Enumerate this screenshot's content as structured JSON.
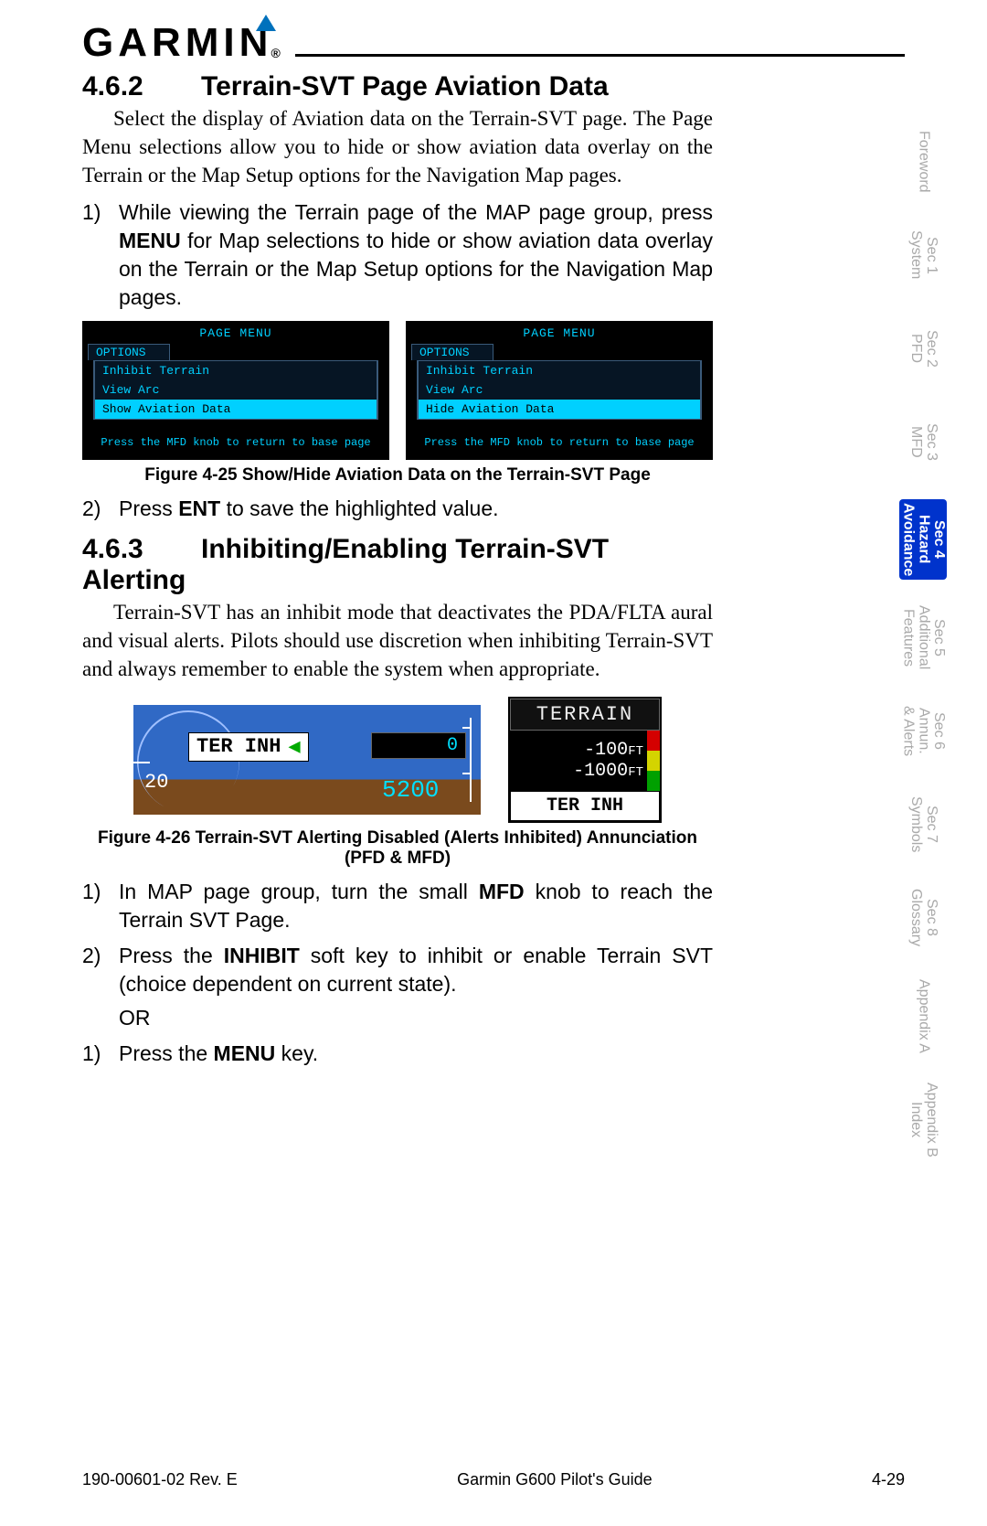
{
  "header": {
    "brand": "GARMIN",
    "reg": "®"
  },
  "tabs": [
    {
      "label": "Foreword"
    },
    {
      "label": "Sec 1\nSystem"
    },
    {
      "label": "Sec 2\nPFD"
    },
    {
      "label": "Sec 3\nMFD"
    },
    {
      "label": "Sec 4\nHazard\nAvoidance",
      "active": true
    },
    {
      "label": "Sec 5\nAdditional\nFeatures"
    },
    {
      "label": "Sec 6\nAnnun.\n& Alerts"
    },
    {
      "label": "Sec 7\nSymbols"
    },
    {
      "label": "Sec 8\nGlossary"
    },
    {
      "label": "Appendix A"
    },
    {
      "label": "Appendix B\nIndex"
    }
  ],
  "s462": {
    "num": "4.6.2",
    "title": "Terrain-SVT Page Aviation Data",
    "intro": "Select the display of Aviation data on the Terrain-SVT page. The Page Menu selections allow you to hide or show aviation data overlay on the Terrain or the Map Setup options for the Navigation Map pages.",
    "step1_n": "1)",
    "step1_t_a": "While viewing the Terrain page of the MAP page group, press ",
    "step1_t_bold": "MENU",
    "step1_t_b": " for Map selections to hide or show aviation data overlay on the Terrain or the Map Setup options for the Navigation Map pages.",
    "step2_n": "2)",
    "step2_t_a": "Press ",
    "step2_t_bold": "ENT",
    "step2_t_b": " to save the highlighted value."
  },
  "fig25": {
    "caption": "Figure 4-25  Show/Hide Aviation Data on the Terrain-SVT Page",
    "menu_title": "PAGE MENU",
    "options_label": "OPTIONS",
    "items_left": [
      "Inhibit Terrain",
      "View Arc",
      "Show Aviation Data"
    ],
    "items_right": [
      "Inhibit Terrain",
      "View Arc",
      "Hide Aviation Data"
    ],
    "hl_index": 2,
    "foot": "Press the MFD knob to return to base page"
  },
  "s463": {
    "num": "4.6.3",
    "title": "Inhibiting/Enabling Terrain-SVT Alerting",
    "intro": "Terrain-SVT has an inhibit mode that deactivates the PDA/FLTA aural and visual alerts. Pilots should use discretion when inhibiting Terrain-SVT and always remember to enable the system when appropriate.",
    "step1_n": "1)",
    "step1_t_a": "In MAP page group, turn the small ",
    "step1_t_bold": "MFD",
    "step1_t_b": " knob to reach the Terrain SVT Page.",
    "step2_n": "2)",
    "step2_t_a": "Press the ",
    "step2_t_bold": "INHIBIT",
    "step2_t_b": " soft key to inhibit or enable Terrain SVT (choice dependent on current state).",
    "step2_or": "OR",
    "step3_n": "1)",
    "step3_t_a": "Press the ",
    "step3_t_bold": "MENU",
    "step3_t_b": " key."
  },
  "fig26": {
    "caption": "Figure 4-26  Terrain-SVT Alerting Disabled (Alerts Inhibited) Annunciation (PFD & MFD)",
    "pfd_inh": "TER INH",
    "pfd_zero": "0",
    "pfd_alt": "5200",
    "pfd_20": "20",
    "mfd_title": "TERRAIN",
    "mfd_l1": "-100",
    "mfd_u1": "FT",
    "mfd_l2": "-1000",
    "mfd_u2": "FT",
    "mfd_inh": "TER INH"
  },
  "footer": {
    "left": "190-00601-02  Rev. E",
    "center": "Garmin G600 Pilot's Guide",
    "right": "4-29"
  }
}
